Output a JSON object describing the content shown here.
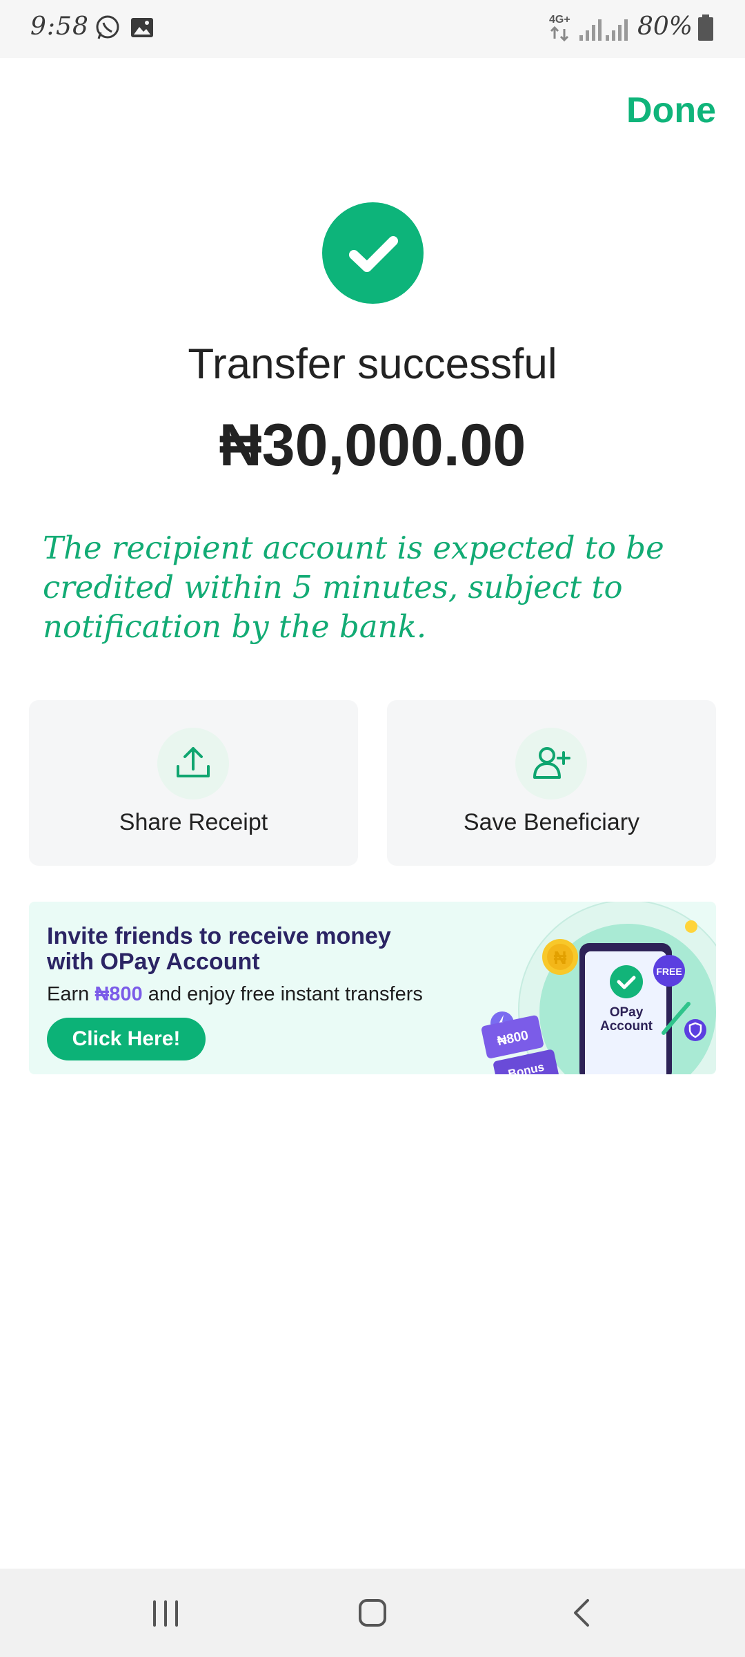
{
  "status_bar": {
    "time": "9:58",
    "network": "4G+",
    "battery": "80%",
    "icons": [
      "whatsapp-icon",
      "gallery-icon",
      "signal-icon",
      "battery-icon"
    ]
  },
  "header": {
    "done_label": "Done"
  },
  "result": {
    "title": "Transfer successful",
    "amount": "₦30,000.00",
    "note": "The recipient account is expected to be credited within 5 minutes, subject to notification by the bank."
  },
  "actions": [
    {
      "label": "Share Receipt",
      "icon": "upload-icon"
    },
    {
      "label": "Save Beneficiary",
      "icon": "add-user-icon"
    }
  ],
  "banner": {
    "title": "Invite friends to receive money with OPay Account",
    "sub_prefix": "Earn ",
    "sub_highlight": "₦800",
    "sub_suffix": " and enjoy free instant transfers",
    "button_label": "Click Here!",
    "art_coin": "₦",
    "art_free": "FREE",
    "art_ticket": "₦800",
    "art_bonus": "Bonus",
    "art_phone_line1": "OPay",
    "art_phone_line2": "Account"
  },
  "colors": {
    "accent": "#0fb47a",
    "banner_bg": "#eafbf6",
    "banner_title": "#2b2464",
    "highlight": "#7b5ce8"
  }
}
